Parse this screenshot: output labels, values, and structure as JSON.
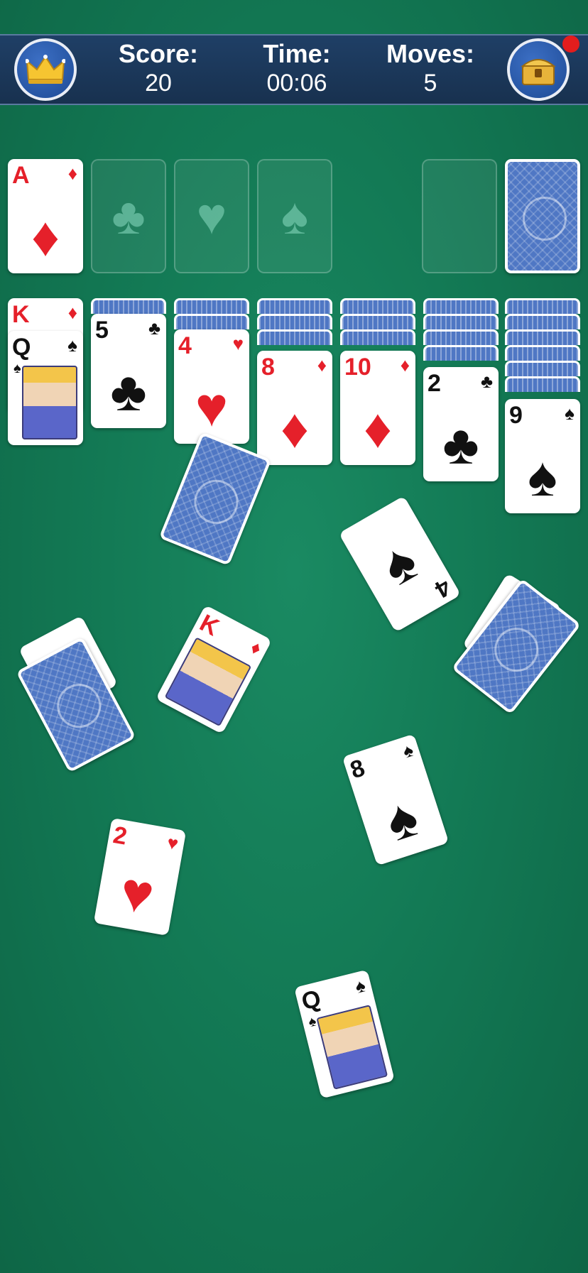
{
  "stats": {
    "score_label": "Score:",
    "score_value": "20",
    "time_label": "Time:",
    "time_value": "00:06",
    "moves_label": "Moves:",
    "moves_value": "5"
  },
  "icons": {
    "left_button": "crown-icon",
    "right_button": "treasure-chest-icon"
  },
  "foundations": [
    {
      "rank": "A",
      "suit": "♦"
    },
    {
      "placeholder": "♣"
    },
    {
      "placeholder": "♥"
    },
    {
      "placeholder": "♠"
    }
  ],
  "tableau": [
    {
      "top_rank": "K",
      "top_suit": "♦",
      "rank": "Q",
      "suit": "♠"
    },
    {
      "rank": "5",
      "suit": "♣"
    },
    {
      "rank": "4",
      "suit": "♥"
    },
    {
      "rank": "8",
      "suit": "♦"
    },
    {
      "rank": "10",
      "suit": "♦"
    },
    {
      "rank": "2",
      "suit": "♣"
    },
    {
      "rank": "9",
      "suit": "♠"
    }
  ],
  "flying_cards": [
    {
      "rank": "4",
      "suit": "♠"
    },
    {
      "rank": "K",
      "suit": "♦"
    },
    {
      "rank": "8",
      "suit": "♠"
    },
    {
      "rank": "2",
      "suit": "♥"
    },
    {
      "rank": "Q",
      "suit": "♠"
    }
  ],
  "colors": {
    "felt": "#137a55",
    "red_suit": "#e5202a",
    "card_back": "#4f77c4"
  }
}
